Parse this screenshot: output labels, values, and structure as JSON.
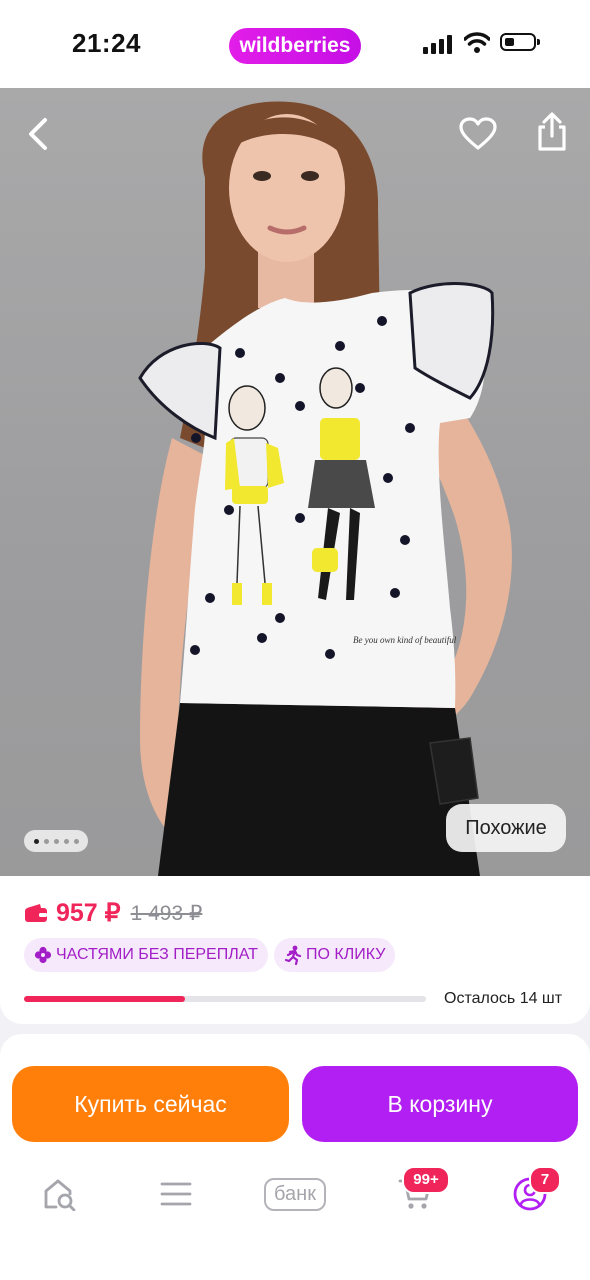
{
  "status_bar": {
    "time": "21:24",
    "brand": "wildberries"
  },
  "product_photo": {
    "print_caption": "Be you own kind of beautiful",
    "similar_label": "Похожие",
    "gallery_total": 5,
    "gallery_current": 1
  },
  "price": {
    "current": "957 ₽",
    "old": "1 493 ₽"
  },
  "chips": [
    {
      "label": "ЧАСТЯМИ БЕЗ ПЕРЕПЛАТ",
      "icon": "flower-icon"
    },
    {
      "label": "ПО КЛИКУ",
      "icon": "running-person-icon"
    }
  ],
  "stock": {
    "label": "Осталось 14 шт",
    "progress": 0.4
  },
  "actions": {
    "buy_now": "Купить сейчас",
    "add_to_cart": "В корзину"
  },
  "tabbar": {
    "bank_label": "банк",
    "cart_badge": "99+",
    "profile_badge": "7"
  },
  "colors": {
    "accent": "#b11ff2",
    "price": "#f0255a",
    "buy": "#ff7f0a"
  }
}
